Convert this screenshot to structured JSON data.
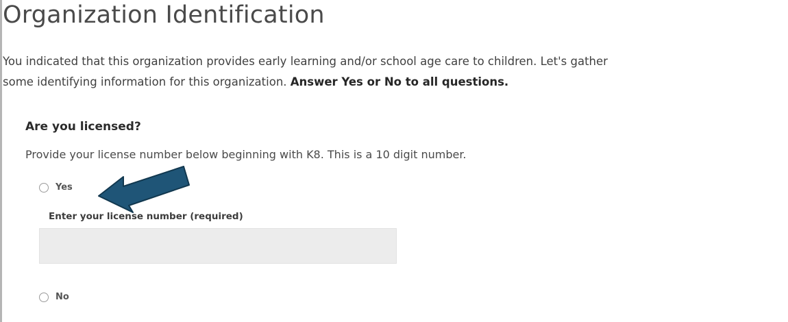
{
  "page": {
    "title": "Organization Identification",
    "intro_line1": "You indicated that this organization provides early learning and/or school age care to children. Let's gather",
    "intro_line2": "some identifying information for this organization.",
    "intro_emphasis": "Answer Yes or No to all questions."
  },
  "license_question": {
    "question": "Are you licensed?",
    "help_text": "Provide your license number below beginning with K8. This is a 10 digit number.",
    "options": [
      {
        "label": "Yes",
        "selected": false
      },
      {
        "label": "No",
        "selected": false
      }
    ],
    "license_field": {
      "label": "Enter your license number (required)",
      "value": "",
      "placeholder": ""
    }
  },
  "annotation": {
    "arrow_icon": "callout-arrow-icon",
    "arrow_color": "#1f5577"
  },
  "colors": {
    "input_background": "#ececec",
    "left_rule": "#b5b5b5"
  }
}
